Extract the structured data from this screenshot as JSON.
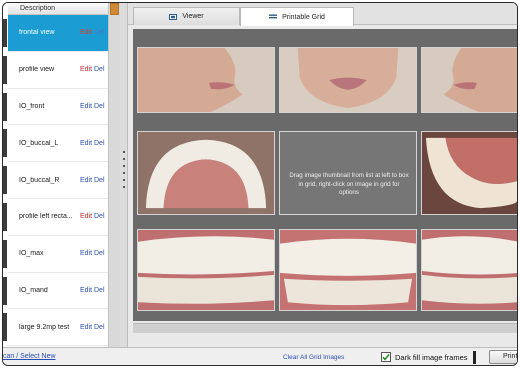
{
  "left_panel": {
    "column_header": "Description",
    "rows": [
      {
        "label": "frontal view",
        "edit": "Edit",
        "del": "Del",
        "selected": true
      },
      {
        "label": "profile view",
        "edit": "Edit",
        "del": "Del"
      },
      {
        "label": "IO_front",
        "edit": "Edit",
        "del": "Del"
      },
      {
        "label": "IO_buccal_L",
        "edit": "Edit",
        "del": "Del"
      },
      {
        "label": "IO_buccal_R",
        "edit": "Edit",
        "del": "Del"
      },
      {
        "label": "profile left recta...",
        "edit": "Edit",
        "del": "Del"
      },
      {
        "label": "IO_max",
        "edit": "Edit",
        "del": "Del"
      },
      {
        "label": "IO_mand",
        "edit": "Edit",
        "del": "Del"
      },
      {
        "label": "large 9.2mp test",
        "edit": "Edit",
        "del": "Del"
      }
    ]
  },
  "tabs": [
    {
      "label": "Viewer",
      "icon": "image-icon"
    },
    {
      "label": "Printable Grid",
      "icon": "grid-icon",
      "active": true
    }
  ],
  "grid": {
    "hint": "Drag image thumbnail from list at left to box in grid, right-click on image in grid for options"
  },
  "bottom_bar": {
    "scan_link": "can / Select New",
    "clear_link": "Clear All Grid Images",
    "dark_fill_label": "Dark fill image frames",
    "dark_fill_checked": true,
    "print_button": "Print I"
  },
  "colors": {
    "selection": "#1b9dd4",
    "link": "#2d4fb0",
    "grid_bg": "#6a6a6a"
  }
}
